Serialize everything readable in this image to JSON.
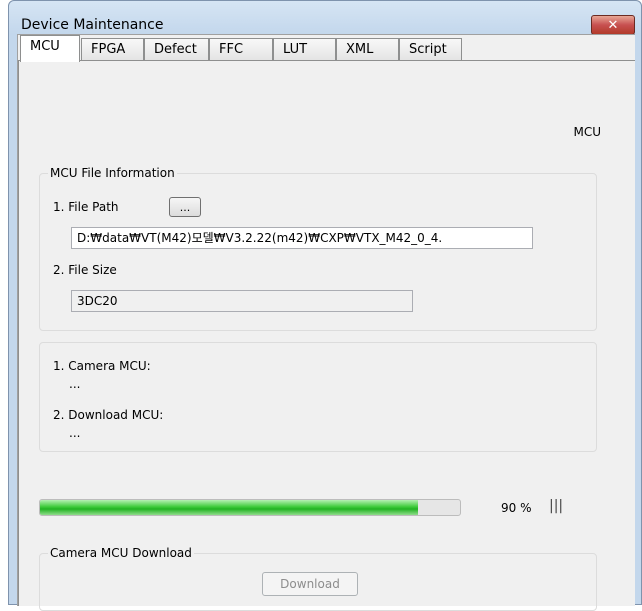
{
  "window": {
    "title": "Device Maintenance",
    "close_glyph": "✕",
    "accent": "#c3d7ec",
    "close_color": "#c75050"
  },
  "tabs": [
    {
      "label": "MCU",
      "active": true
    },
    {
      "label": "FPGA",
      "active": false
    },
    {
      "label": "Defect",
      "active": false
    },
    {
      "label": "FFC",
      "active": false
    },
    {
      "label": "LUT",
      "active": false
    },
    {
      "label": "XML",
      "active": false
    },
    {
      "label": "Script",
      "active": false
    }
  ],
  "panel": {
    "mode_label": "MCU"
  },
  "file_info": {
    "group_title": "MCU File Information",
    "file_path_label": "1. File Path",
    "browse_label": "...",
    "file_path_value": "D:₩data₩VT(M42)모델₩V3.2.22(m42)₩CXP₩VTX_M42_0_4.",
    "file_size_label": "2. File Size",
    "file_size_value": "3DC20"
  },
  "versions": {
    "camera_label": "1. Camera MCU:",
    "camera_value": "...",
    "download_label": "2. Download MCU:",
    "download_value": "..."
  },
  "progress": {
    "percent": 90,
    "percent_text": "90 %",
    "busy_glyph": "|||",
    "fill_color": "#22b322"
  },
  "download": {
    "group_title": "Camera MCU Download",
    "button_label": "Download",
    "enabled": false
  }
}
